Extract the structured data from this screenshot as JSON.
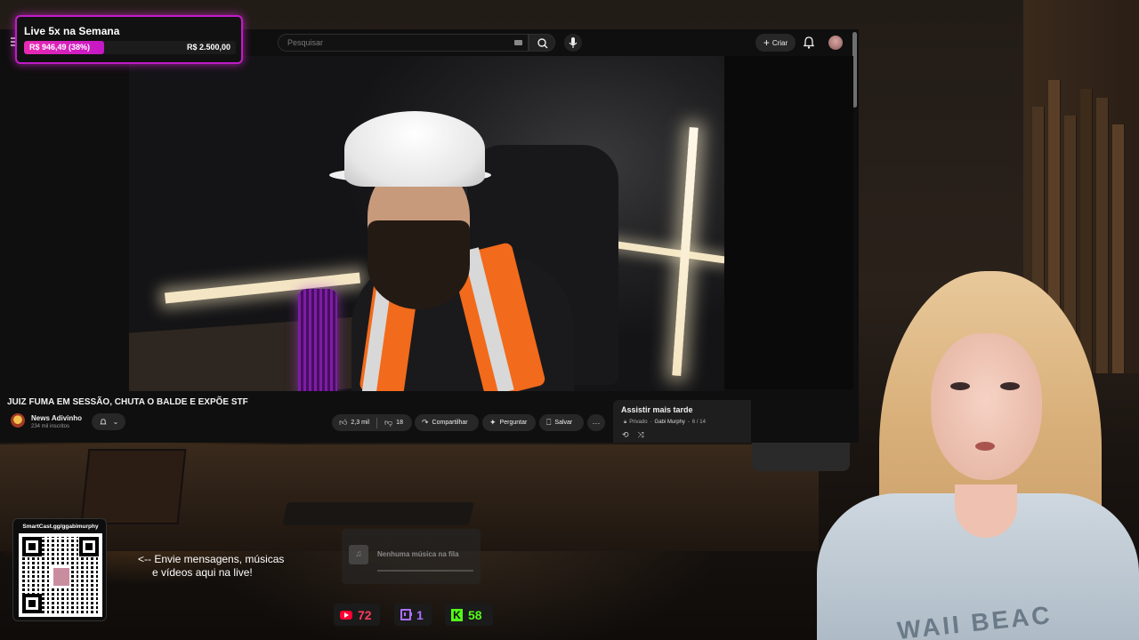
{
  "goal": {
    "title": "Live 5x na Semana",
    "current": "R$ 946,49 (38%)",
    "target": "R$ 2.500,00",
    "progress": 0.38,
    "colors": {
      "border": "#c01cc8",
      "fill": "#e72ab2"
    }
  },
  "youtube": {
    "search_placeholder": "Pesquisar",
    "create_label": "Criar",
    "video_title": "JUIZ FUMA EM SESSÃO, CHUTA O BALDE E EXPÕE STF",
    "channel": {
      "name": "News Adivinho",
      "subscribers": "234 mil inscritos"
    },
    "actions": {
      "likes": "2,3 mil",
      "dislikes": "18",
      "share": "Compartilhar",
      "ask": "Perguntar",
      "save": "Salvar"
    },
    "playlist": {
      "title": "Assistir mais tarde",
      "privacy": "Privado",
      "owner": "Gabi Murphy",
      "position": "6 / 14"
    }
  },
  "overlays": {
    "qr_url": "SmartCast.gg/ggabimurphy",
    "message_line1": "<-- Envie mensagens, músicas",
    "message_line2": "e vídeos aqui na live!",
    "music_queue": "Nenhuma música na fila",
    "viewers": {
      "youtube": "72",
      "twitch": "1",
      "kick": "58"
    },
    "colors": {
      "youtube": "#ff3b5c",
      "twitch": "#a970ff",
      "kick": "#53fc18"
    }
  },
  "streamer_shirt_text": "WAII BEAC"
}
